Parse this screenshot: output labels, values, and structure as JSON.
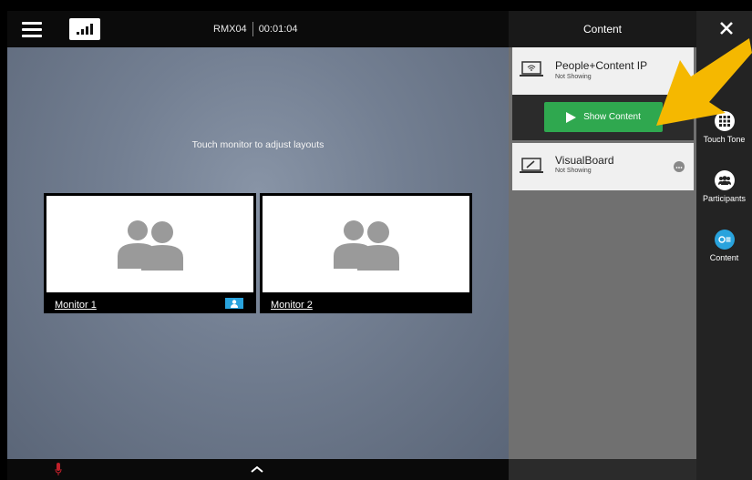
{
  "topbar": {
    "room_name": "RMX04",
    "call_duration": "00:01:04",
    "menu_icon": "hamburger-menu-icon",
    "signal_icon": "signal-strength-icon"
  },
  "main": {
    "hint": "Touch monitor to adjust layouts",
    "monitors": [
      {
        "label": "Monitor 1",
        "badge_icon": "person-icon"
      },
      {
        "label": "Monitor 2"
      }
    ]
  },
  "panel": {
    "title": "Content",
    "sources": [
      {
        "name": "People+Content IP",
        "status": "Not Showing",
        "icon": "laptop-wireless-icon"
      },
      {
        "name": "VisualBoard",
        "status": "Not Showing",
        "icon": "whiteboard-pen-icon"
      }
    ],
    "show_button": "Show Content"
  },
  "rail": {
    "items": [
      {
        "label": "Touch Tone",
        "icon": "keypad-icon"
      },
      {
        "label": "Participants",
        "icon": "participants-icon"
      },
      {
        "label": "Content",
        "icon": "content-share-icon"
      }
    ]
  },
  "colors": {
    "accent_green": "#2fa84f",
    "accent_blue": "#29a3dd",
    "annotation_arrow": "#f5b800"
  }
}
